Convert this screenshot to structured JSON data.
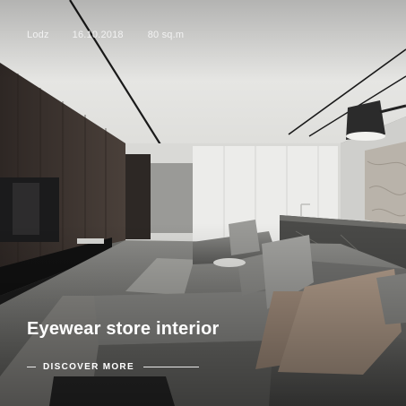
{
  "meta": {
    "location": "Lodz",
    "date": "16.10.2018",
    "area": "80 sq.m"
  },
  "title": "Eyewear store interior",
  "cta": {
    "label": "DISCOVER MORE"
  },
  "colors": {
    "ceiling": "#e9e9e7",
    "wood_wall": "#3a332f",
    "floor": "#7a7a77",
    "sofa": "#7f7f7c",
    "text": "#ffffff"
  }
}
